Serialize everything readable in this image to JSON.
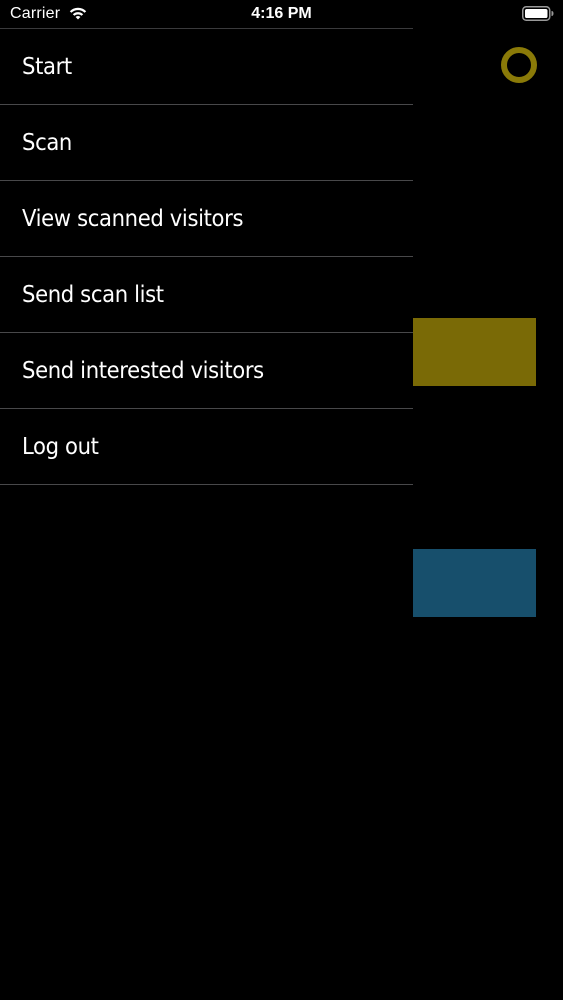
{
  "status_bar": {
    "carrier": "Carrier",
    "time": "4:16 PM",
    "wifi_icon": "wifi-icon",
    "battery_icon": "battery-icon"
  },
  "drawer": {
    "items": [
      {
        "label": "Start"
      },
      {
        "label": "Scan"
      },
      {
        "label": "View scanned visitors"
      },
      {
        "label": "Send scan list"
      },
      {
        "label": "Send interested visitors"
      },
      {
        "label": "Log out"
      }
    ]
  },
  "background": {
    "settings_icon": "settings-ring-icon",
    "colors": {
      "accent_yellow": "#7a6a06",
      "accent_blue": "#174f6c",
      "ring": "#8a7a08"
    }
  }
}
